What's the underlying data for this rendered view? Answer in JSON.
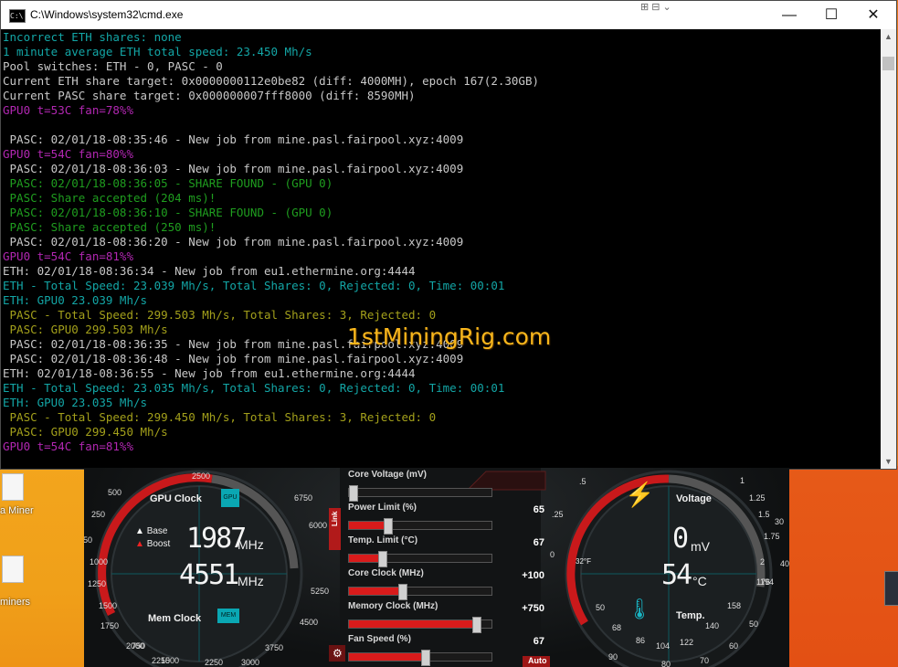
{
  "window": {
    "title": "C:\\Windows\\system32\\cmd.exe",
    "minimize": "—",
    "maximize": "☐",
    "close": "✕"
  },
  "console_lines": [
    {
      "text": "Incorrect ETH shares: none",
      "color": "teal"
    },
    {
      "text": "1 minute average ETH total speed: 23.450 Mh/s",
      "color": "teal"
    },
    {
      "text": "Pool switches: ETH - 0, PASC - 0",
      "color": "white"
    },
    {
      "text": "Current ETH share target: 0x0000000112e0be82 (diff: 4000MH), epoch 167(2.30GB)",
      "color": "white"
    },
    {
      "text": "Current PASC share target: 0x000000007fff8000 (diff: 8590MH)",
      "color": "white"
    },
    {
      "text": "GPU0 t=53C fan=78%%",
      "color": "mag"
    },
    {
      "text": "",
      "color": "white"
    },
    {
      "text": " PASC: 02/01/18-08:35:46 - New job from mine.pasl.fairpool.xyz:4009",
      "color": "white"
    },
    {
      "text": "GPU0 t=54C fan=80%%",
      "color": "mag"
    },
    {
      "text": " PASC: 02/01/18-08:36:03 - New job from mine.pasl.fairpool.xyz:4009",
      "color": "white"
    },
    {
      "text": " PASC: 02/01/18-08:36:05 - SHARE FOUND - (GPU 0)",
      "color": "green"
    },
    {
      "text": " PASC: Share accepted (204 ms)!",
      "color": "green"
    },
    {
      "text": " PASC: 02/01/18-08:36:10 - SHARE FOUND - (GPU 0)",
      "color": "green"
    },
    {
      "text": " PASC: Share accepted (250 ms)!",
      "color": "green"
    },
    {
      "text": " PASC: 02/01/18-08:36:20 - New job from mine.pasl.fairpool.xyz:4009",
      "color": "white"
    },
    {
      "text": "GPU0 t=54C fan=81%%",
      "color": "mag"
    },
    {
      "text": "ETH: 02/01/18-08:36:34 - New job from eu1.ethermine.org:4444",
      "color": "white"
    },
    {
      "text": "ETH - Total Speed: 23.039 Mh/s, Total Shares: 0, Rejected: 0, Time: 00:01",
      "color": "teal"
    },
    {
      "text": "ETH: GPU0 23.039 Mh/s",
      "color": "teal"
    },
    {
      "text": " PASC - Total Speed: 299.503 Mh/s, Total Shares: 3, Rejected: 0",
      "color": "olive"
    },
    {
      "text": " PASC: GPU0 299.503 Mh/s",
      "color": "olive"
    },
    {
      "text": " PASC: 02/01/18-08:36:35 - New job from mine.pasl.fairpool.xyz:4009",
      "color": "white"
    },
    {
      "text": " PASC: 02/01/18-08:36:48 - New job from mine.pasl.fairpool.xyz:4009",
      "color": "white"
    },
    {
      "text": "ETH: 02/01/18-08:36:55 - New job from eu1.ethermine.org:4444",
      "color": "white"
    },
    {
      "text": "ETH - Total Speed: 23.035 Mh/s, Total Shares: 0, Rejected: 0, Time: 00:01",
      "color": "teal"
    },
    {
      "text": "ETH: GPU0 23.035 Mh/s",
      "color": "teal"
    },
    {
      "text": " PASC - Total Speed: 299.450 Mh/s, Total Shares: 3, Rejected: 0",
      "color": "olive"
    },
    {
      "text": " PASC: GPU0 299.450 Mh/s",
      "color": "olive"
    },
    {
      "text": "GPU0 t=54C fan=81%%",
      "color": "mag"
    }
  ],
  "colors": {
    "teal": "#13a6a6",
    "white": "#c8c8c8",
    "mag": "#b227b2",
    "green": "#1f9e1f",
    "olive": "#a3a01b"
  },
  "watermark": "1stMiningRig.com",
  "desktop": {
    "icon1_label": "a Miner",
    "icon2_label": "miners"
  },
  "afterburner": {
    "left_gauge": {
      "gpu_clock_label": "GPU Clock",
      "gpu_chip": "GPU",
      "mem_clock_label": "Mem Clock",
      "mem_chip": "MEM",
      "base_label": "Base",
      "boost_label": "Boost",
      "gpu_value": "1987",
      "gpu_unit": "MHz",
      "mem_value": "4551",
      "mem_unit": "MHz",
      "ticks": [
        "500",
        "250",
        "750",
        "1000",
        "1250",
        "1500",
        "1750",
        "2000",
        "2250",
        "2500",
        "6750",
        "6000",
        "5250",
        "4500",
        "3750",
        "3000",
        "2250",
        "1500",
        "750"
      ]
    },
    "sliders": [
      {
        "label": "Core Voltage (mV)",
        "value": "",
        "level": 0.0
      },
      {
        "label": "Power Limit (%)",
        "value": "65",
        "level": 0.27
      },
      {
        "label": "Temp. Limit (°C)",
        "value": "67",
        "level": 0.23
      },
      {
        "label": "Core Clock (MHz)",
        "value": "+100",
        "level": 0.37
      },
      {
        "label": "Memory Clock (MHz)",
        "value": "+750",
        "level": 0.89
      },
      {
        "label": "Fan Speed (%)",
        "value": "67",
        "level": 0.53
      }
    ],
    "link_label": "Link",
    "auto_label": "Auto",
    "right_gauge": {
      "voltage_label": "Voltage",
      "voltage_value": "0",
      "voltage_unit": "mV",
      "temp_label": "Temp.",
      "temp_value": "54",
      "temp_unit": "°C",
      "fahrenheit_marker": "32°F",
      "ticks": [
        ".5",
        ".25",
        "0",
        "1",
        "1.25",
        "1.5",
        "1.75",
        "2",
        "50",
        "68",
        "86",
        "104",
        "122",
        "140",
        "158",
        "176",
        "194",
        "30",
        "40",
        "50",
        "60",
        "70",
        "80",
        "90"
      ]
    }
  }
}
